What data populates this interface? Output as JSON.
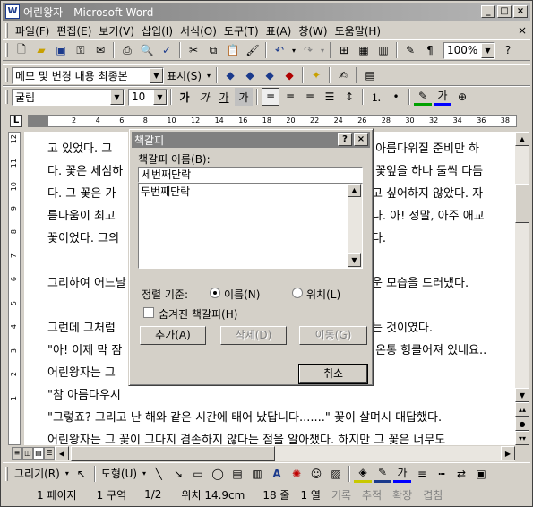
{
  "window": {
    "title": "어린왕자 - Microsoft Word",
    "icon_letter": "W"
  },
  "menu": [
    "파일(F)",
    "편집(E)",
    "보기(V)",
    "삽입(I)",
    "서식(O)",
    "도구(T)",
    "표(A)",
    "창(W)",
    "도움말(H)"
  ],
  "toolbar1": {
    "zoom": "100%"
  },
  "toolbar2": {
    "review_combo": "메모 및 변경 내용 최종본",
    "show_label": "표시(S)"
  },
  "toolbar3": {
    "font": "굴림",
    "size": "10"
  },
  "ruler": {
    "corner": "L",
    "ticks": [
      "2",
      "4",
      "6",
      "8",
      "10",
      "12",
      "14",
      "16",
      "18",
      "20",
      "22",
      "24",
      "26",
      "28",
      "30",
      "32",
      "34",
      "36",
      "38"
    ],
    "vticks": [
      "12",
      "11",
      "10",
      "9",
      "8",
      "7",
      "6",
      "5",
      "4",
      "3",
      "2",
      "1"
    ]
  },
  "document": {
    "lines": [
      "고 있었다. 그",
      "다. 꽃은 세심하",
      "다. 그 꽃은 가",
      "름다움이 최고",
      "꽃이었다. 그의",
      "",
      "그리하여 어느날",
      "",
      "그런데 그처럼",
      "\"아! 이제 막 잠",
      "어린왕자는 그",
      "\"참 아름다우시",
      "\"그렇죠? 그리고 난 해와 같은 시간에 태어 났답니다.......\" 꽃이 살며시 대답했다.",
      "어린왕자는 그 꽃이 그다지 겸손하지 않다는 점을 알아챘다. 하지만 그 꽃은 너무도"
    ],
    "right_fragments": [
      "고 아름다워질 준비만 하",
      "고 꽃잎을 하나 둘씩 다듬",
      "내고 싶어하지 않았다. 자",
      "했다. 아! 정말, 아주 애교",
      "었다.",
      "",
      "운 모습을 드러냈다.",
      "",
      "하는 것이였다.",
      "아 온통 헝클어져 있네요..",
      "",
      ""
    ]
  },
  "dialog": {
    "title": "책갈피",
    "name_label": "책갈피 이름(B):",
    "name_value": "세번째단락",
    "list_items": [
      "두번째단락"
    ],
    "sort_label": "정렬 기준:",
    "sort_name": "이름(N)",
    "sort_location": "위치(L)",
    "hidden_label": "숨겨진 책갈피(H)",
    "add_button": "추가(A)",
    "delete_button": "삭제(D)",
    "goto_button": "이동(G)",
    "cancel_button": "취소"
  },
  "drawbar": {
    "draw_label": "그리기(R)",
    "autoshape_label": "도형(U)"
  },
  "status": {
    "page": "1 페이지",
    "section": "1 구역",
    "page_of": "1/2",
    "position": "위치 14.9cm",
    "line": "18 줄",
    "column": "1 열",
    "rec": "기록",
    "trk": "추적",
    "ext": "확장",
    "ovr": "겹침"
  }
}
